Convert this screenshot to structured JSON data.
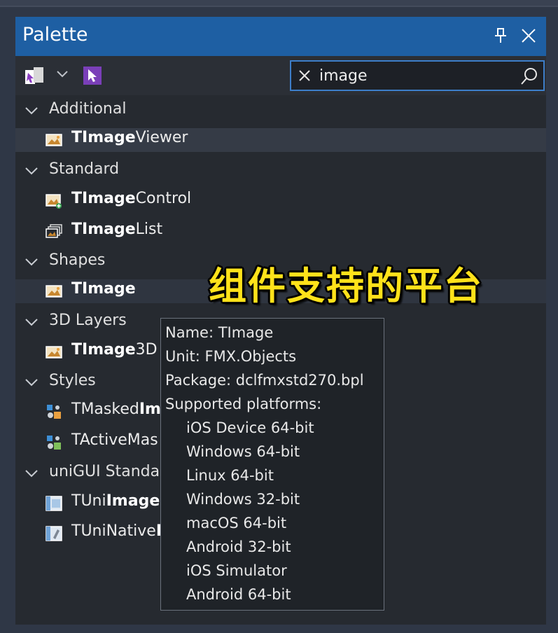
{
  "palette": {
    "title": "Palette",
    "search": {
      "value": "image",
      "placeholder": ""
    },
    "categories": [
      {
        "label": "Additional",
        "items": [
          {
            "bold": "TImage",
            "rest": "Viewer",
            "icon": "image-component-icon"
          }
        ]
      },
      {
        "label": "Standard",
        "items": [
          {
            "bold": "TImage",
            "rest": "Control",
            "icon": "image-control-icon"
          },
          {
            "bold": "TImage",
            "rest": "List",
            "icon": "image-list-icon"
          }
        ]
      },
      {
        "label": "Shapes",
        "items": [
          {
            "bold": "TImage",
            "rest": "",
            "icon": "image-component-icon"
          }
        ]
      },
      {
        "label": "3D Layers",
        "items": [
          {
            "bold": "TImage",
            "rest": "3D",
            "pre": "",
            "icon": "image-component-icon"
          }
        ]
      },
      {
        "label": "Styles",
        "items": [
          {
            "pre": "TMasked",
            "bold": "Im",
            "rest": "",
            "icon": "styles-component-icon"
          },
          {
            "pre": "TActiveMas",
            "bold": "",
            "rest": "",
            "icon": "styles-component-icon"
          }
        ]
      },
      {
        "label": "uniGUI Standar",
        "items": [
          {
            "pre": "TUni",
            "bold": "ImageL",
            "rest": "",
            "icon": "unigui-image-icon"
          },
          {
            "pre": "TUniNative",
            "bold": "I",
            "rest": "",
            "icon": "unigui-native-icon"
          }
        ]
      }
    ]
  },
  "overlay_text": "组件支持的平台",
  "tooltip": {
    "name": "Name: TImage",
    "unit": "Unit: FMX.Objects",
    "package": "Package: dclfmxstd270.bpl",
    "platforms_header": "Supported platforms:",
    "platforms": [
      "iOS Device 64-bit",
      "Windows 64-bit",
      "Linux 64-bit",
      "Windows 32-bit",
      "macOS 64-bit",
      "Android 32-bit",
      "iOS Simulator",
      "Android 64-bit"
    ]
  },
  "colors": {
    "titlebar": "#1e5fa3",
    "panel": "#262a30",
    "accent": "#3d7ec9",
    "overlay": "#ffe21a"
  }
}
